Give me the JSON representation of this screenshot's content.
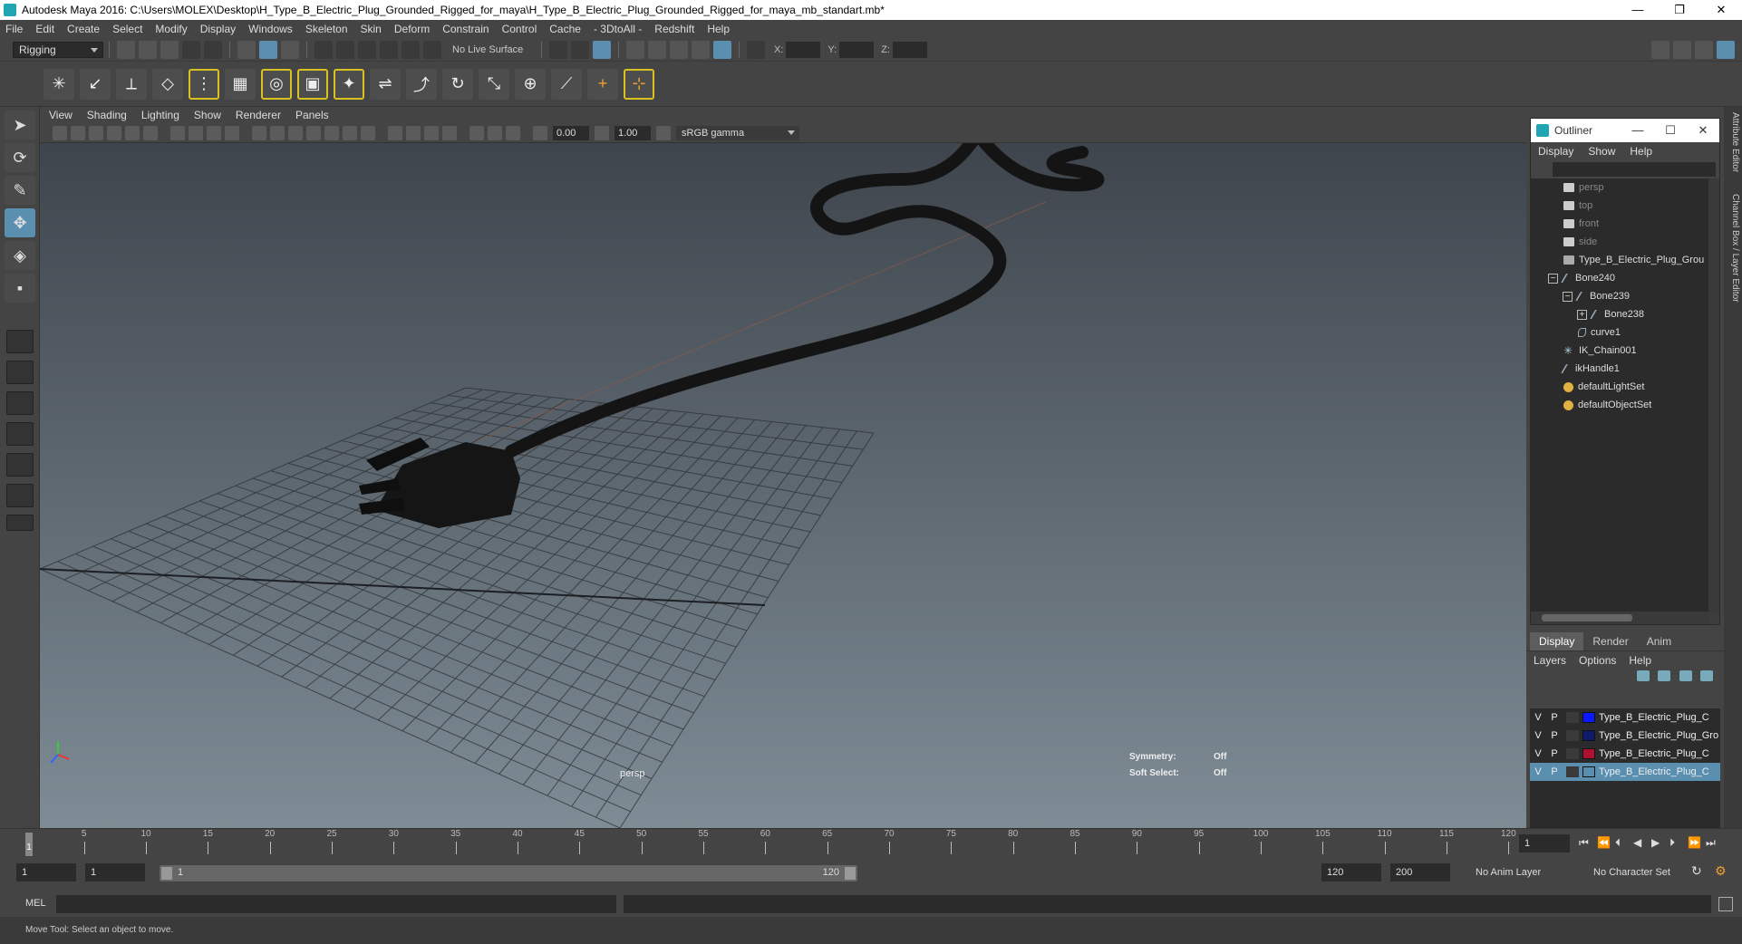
{
  "window": {
    "title": "Autodesk Maya 2016: C:\\Users\\MOLEX\\Desktop\\H_Type_B_Electric_Plug_Grounded_Rigged_for_maya\\H_Type_B_Electric_Plug_Grounded_Rigged_for_maya_mb_standart.mb*",
    "minimize": "—",
    "restore": "❐",
    "close": "✕"
  },
  "menubar": [
    "File",
    "Edit",
    "Create",
    "Select",
    "Modify",
    "Display",
    "Windows",
    "Skeleton",
    "Skin",
    "Deform",
    "Constrain",
    "Control",
    "Cache",
    "- 3DtoAll -",
    "Redshift",
    "Help"
  ],
  "status": {
    "mode": "Rigging",
    "live_surface": "No Live Surface",
    "x_label": "X:",
    "y_label": "Y:",
    "z_label": "Z:"
  },
  "viewport": {
    "menu": [
      "View",
      "Shading",
      "Lighting",
      "Show",
      "Renderer",
      "Panels"
    ],
    "near_value": "0.00",
    "far_value": "1.00",
    "color_space": "sRGB gamma",
    "camera_label": "persp",
    "symmetry_label": "Symmetry:",
    "symmetry_value": "Off",
    "soft_select_label": "Soft Select:",
    "soft_select_value": "Off"
  },
  "outliner": {
    "title": "Outliner",
    "menu": [
      "Display",
      "Show",
      "Help"
    ],
    "items": [
      {
        "label": "persp",
        "icon": "camera-icon"
      },
      {
        "label": "top",
        "icon": "camera-icon"
      },
      {
        "label": "front",
        "icon": "camera-icon"
      },
      {
        "label": "side",
        "icon": "camera-icon"
      },
      {
        "label": "Type_B_Electric_Plug_Grou",
        "icon": "mesh-icon"
      },
      {
        "label": "Bone240",
        "icon": "bone-icon"
      },
      {
        "label": "Bone239",
        "icon": "bone-icon"
      },
      {
        "label": "Bone238",
        "icon": "bone-icon"
      },
      {
        "label": "curve1",
        "icon": "curve-icon"
      },
      {
        "label": "IK_Chain001",
        "icon": "ik-icon"
      },
      {
        "label": "ikHandle1",
        "icon": "ik-handle-icon"
      },
      {
        "label": "defaultLightSet",
        "icon": "set-icon"
      },
      {
        "label": "defaultObjectSet",
        "icon": "set-icon"
      }
    ]
  },
  "sidetabs": {
    "attribute_editor": "Attribute Editor",
    "channel_box": "Channel Box / Layer Editor",
    "channel_box_header": "Channel Box / Layer Editor"
  },
  "layers": {
    "tabs": [
      "Display",
      "Render",
      "Anim"
    ],
    "menu": [
      "Layers",
      "Options",
      "Help"
    ],
    "rows": [
      {
        "v": "V",
        "p": "P",
        "color": "#0a1aff",
        "label": "Type_B_Electric_Plug_C"
      },
      {
        "v": "V",
        "p": "P",
        "color": "#101a6a",
        "label": "Type_B_Electric_Plug_Gro"
      },
      {
        "v": "V",
        "p": "P",
        "color": "#b01030",
        "label": "Type_B_Electric_Plug_C"
      },
      {
        "v": "V",
        "p": "P",
        "color": "#5a8fb0",
        "label": "Type_B_Electric_Plug_C"
      }
    ]
  },
  "timeline": {
    "ticks": [
      "5",
      "10",
      "15",
      "20",
      "25",
      "30",
      "35",
      "40",
      "45",
      "50",
      "55",
      "60",
      "65",
      "70",
      "75",
      "80",
      "85",
      "90",
      "95",
      "100",
      "105",
      "110",
      "115",
      "120"
    ],
    "current_frame": "1",
    "current_frame_box": "1"
  },
  "range": {
    "start": "1",
    "start_inner": "1",
    "slider_start": "1",
    "slider_end": "120",
    "end_inner": "120",
    "end": "200",
    "anim_layer": "No Anim Layer",
    "character_set": "No Character Set"
  },
  "mel": {
    "label": "MEL"
  },
  "help": {
    "text": "Move Tool: Select an object to move."
  }
}
